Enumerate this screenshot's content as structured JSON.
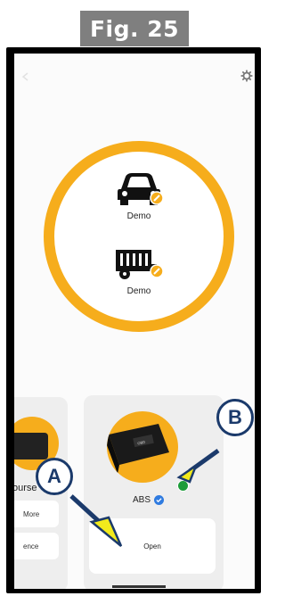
{
  "figure_label": "Fig. 25",
  "vehicles": [
    {
      "label": "Demo",
      "icon": "car-icon"
    },
    {
      "label": "Demo",
      "icon": "truck-trailer-icon"
    }
  ],
  "accent_color": "#f6ad1c",
  "pagination": {
    "active_index": 0,
    "count": 2
  },
  "left_card": {
    "title": "ourse",
    "buttons": [
      "More",
      "ence"
    ]
  },
  "right_card": {
    "title": "ABS",
    "open_label": "Open",
    "status_color": "#1e9c3a"
  },
  "annotations": [
    {
      "letter": "A"
    },
    {
      "letter": "B"
    }
  ],
  "annotation_colors": {
    "circle": "#1b3a6b",
    "arrow": "#f2ea1c"
  }
}
